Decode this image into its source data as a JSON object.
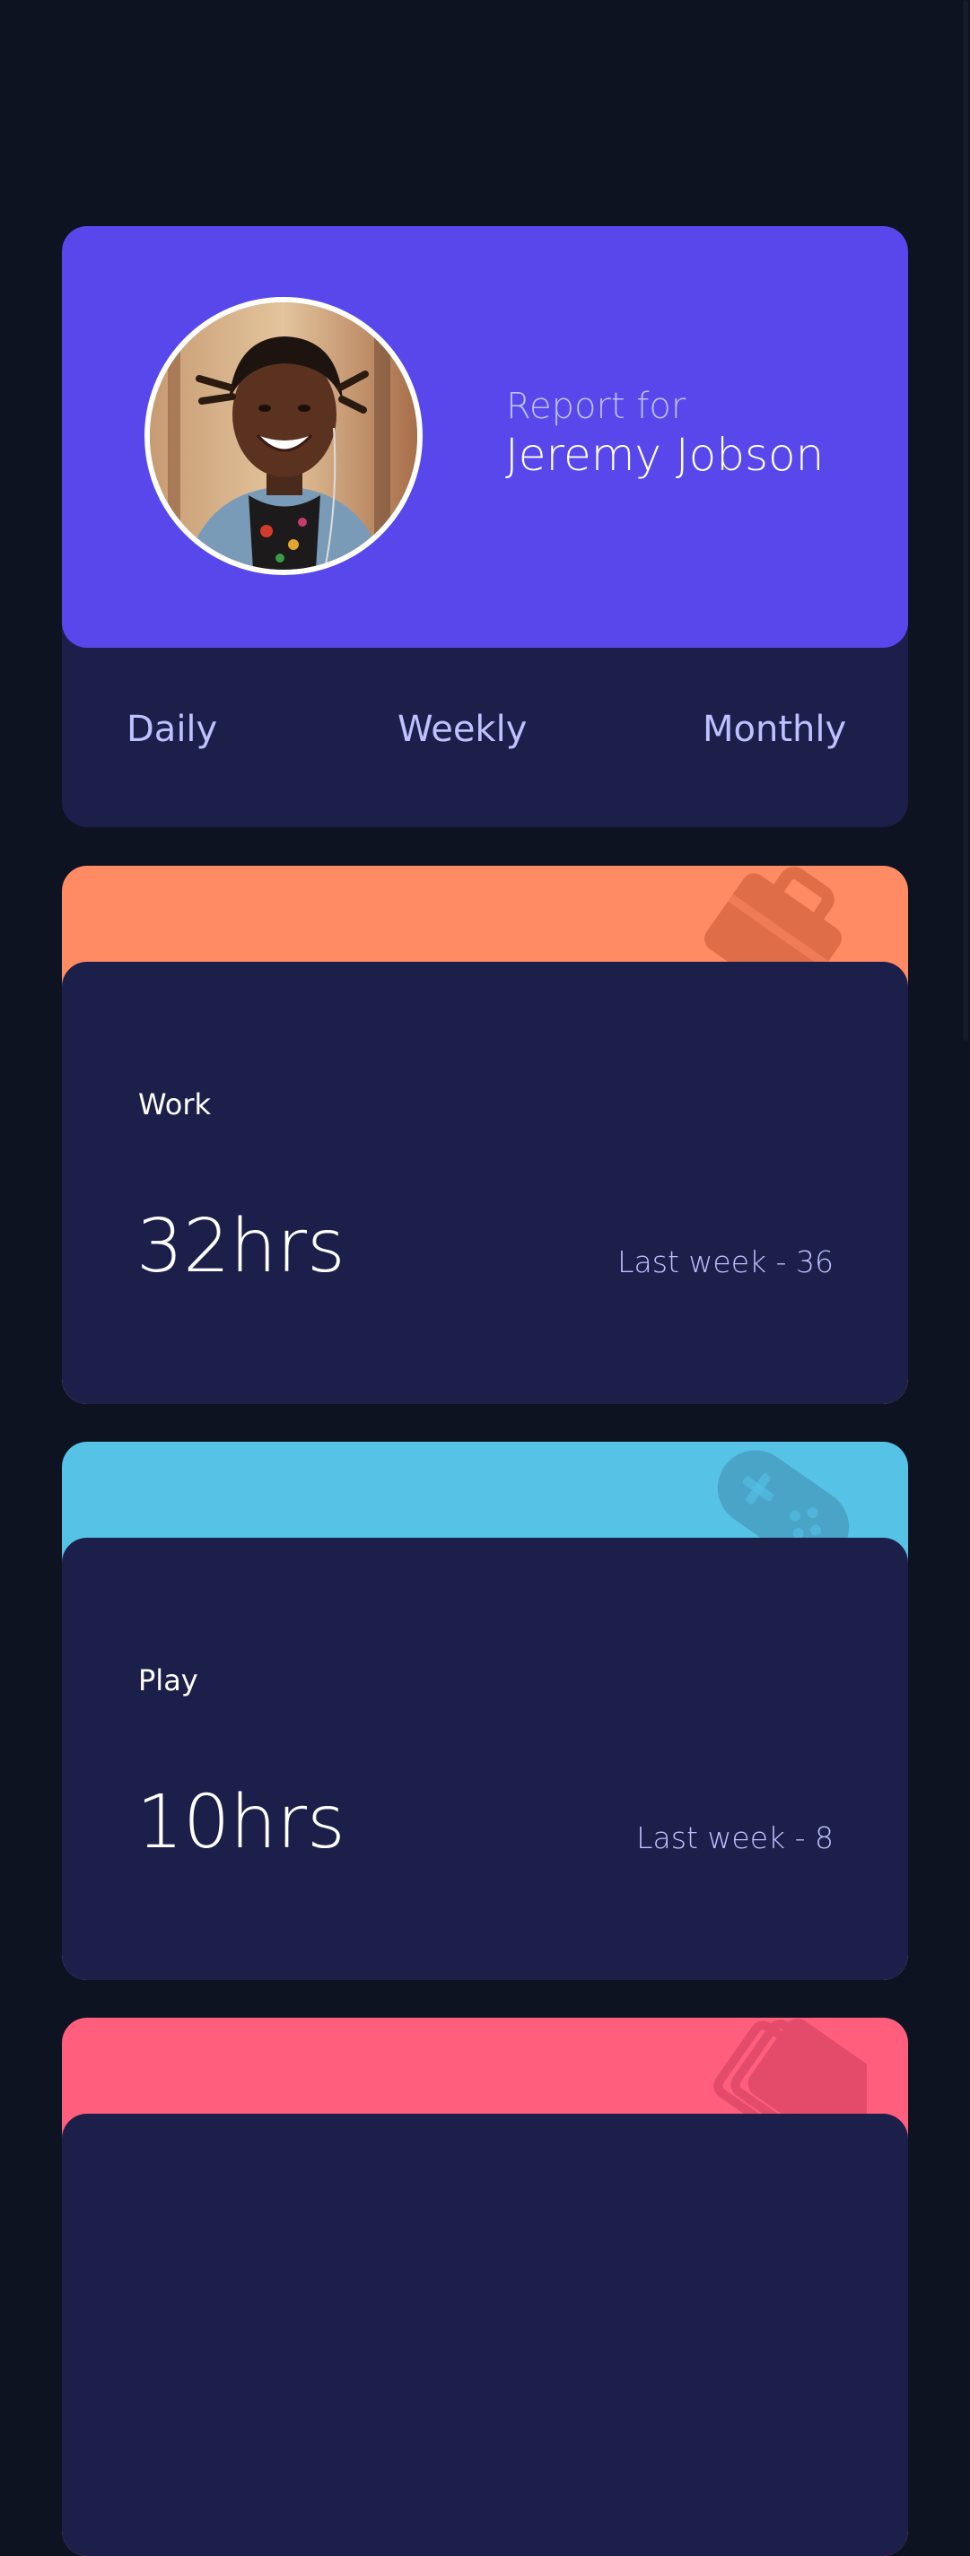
{
  "profile": {
    "report_label": "Report for",
    "name": "Jeremy Jobson"
  },
  "tabs": [
    {
      "label": "Daily"
    },
    {
      "label": "Weekly"
    },
    {
      "label": "Monthly"
    }
  ],
  "activities": [
    {
      "title": "Work",
      "hours": "32hrs",
      "previous": "Last week - 36",
      "color": "#ff8b64",
      "icon": "briefcase-icon"
    },
    {
      "title": "Play",
      "hours": "10hrs",
      "previous": "Last week - 8",
      "color": "#55c2e6",
      "icon": "gamepad-icon"
    },
    {
      "color": "#ff5e7d",
      "icon": "books-icon"
    }
  ],
  "colors": {
    "background": "#0e1322",
    "card": "#1d1f4b",
    "profile": "#5847eb",
    "muted_text": "#bdc1ff"
  }
}
